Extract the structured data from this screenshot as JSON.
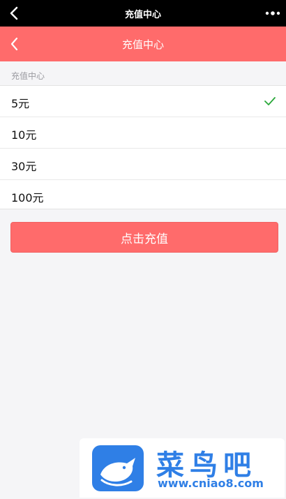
{
  "system_bar": {
    "title": "充值中心"
  },
  "app_bar": {
    "title": "充值中心"
  },
  "section": {
    "label": "充值中心"
  },
  "options": [
    {
      "label": "5元",
      "selected": true
    },
    {
      "label": "10元",
      "selected": false
    },
    {
      "label": "30元",
      "selected": false
    },
    {
      "label": "100元",
      "selected": false
    }
  ],
  "cta": {
    "label": "点击充值"
  },
  "watermark": {
    "name": "菜鸟吧",
    "url": "www.cniao8.com"
  },
  "colors": {
    "primary": "#ff6b6b",
    "check": "#2aa83a",
    "watermark": "#2f7fe6"
  }
}
